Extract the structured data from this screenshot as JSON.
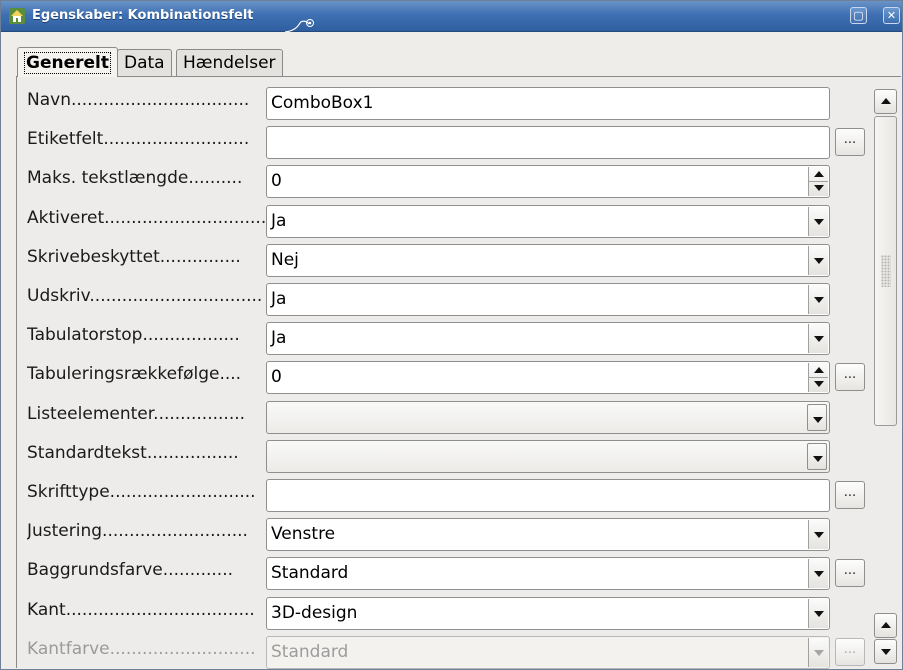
{
  "window": {
    "title": "Egenskaber: Kombinationsfelt",
    "max_glyph": "▢",
    "close_glyph": "✕",
    "icons": [
      "app-house-icon",
      "title-cap-icon",
      "maximize-icon",
      "close-icon"
    ]
  },
  "tabs": [
    {
      "label": "Generelt",
      "active": true
    },
    {
      "label": "Data",
      "active": false
    },
    {
      "label": "Hændelser",
      "active": false
    }
  ],
  "dots_label": "...",
  "properties": [
    {
      "label": "Navn.................................",
      "value": "ComboBox1",
      "control": "text",
      "dots": false,
      "enabled": true
    },
    {
      "label": "Etiketfelt...........................",
      "value": "",
      "control": "text",
      "dots": true,
      "enabled": true
    },
    {
      "label": "Maks. tekstlængde..........",
      "value": "0",
      "control": "spin",
      "dots": false,
      "enabled": true
    },
    {
      "label": "Aktiveret..............................",
      "value": "Ja",
      "control": "dropdown",
      "dots": false,
      "enabled": true
    },
    {
      "label": "Skrivebeskyttet...............",
      "value": "Nej",
      "control": "dropdown",
      "dots": false,
      "enabled": true
    },
    {
      "label": "Udskriv................................",
      "value": "Ja",
      "control": "dropdown",
      "dots": false,
      "enabled": true
    },
    {
      "label": "Tabulatorstop..................",
      "value": "Ja",
      "control": "dropdown",
      "dots": false,
      "enabled": true
    },
    {
      "label": "Tabuleringsrækkefølge....",
      "value": "0",
      "control": "spin",
      "dots": true,
      "enabled": true
    },
    {
      "label": "Listeelementer.................",
      "value": "",
      "control": "listbox",
      "dots": false,
      "enabled": true
    },
    {
      "label": "Standardtekst.................",
      "value": "",
      "control": "listbox",
      "dots": false,
      "enabled": true
    },
    {
      "label": "Skrifttype...........................",
      "value": "",
      "control": "text",
      "dots": true,
      "enabled": true
    },
    {
      "label": "Justering...........................",
      "value": "Venstre",
      "control": "dropdown",
      "dots": false,
      "enabled": true
    },
    {
      "label": "Baggrundsfarve.............",
      "value": "Standard",
      "control": "dropdown",
      "dots": true,
      "enabled": true
    },
    {
      "label": "Kant...................................",
      "value": "3D-design",
      "control": "dropdown",
      "dots": false,
      "enabled": true
    },
    {
      "label": "Kantfarve...........................",
      "value": "Standard",
      "control": "dropdown",
      "dots": true,
      "enabled": false
    }
  ],
  "colors": {
    "title_bar": "#3f70b3",
    "window_bg": "#eeede9",
    "field_bg": "#ffffff",
    "disabled_text": "#9a9a9a"
  }
}
